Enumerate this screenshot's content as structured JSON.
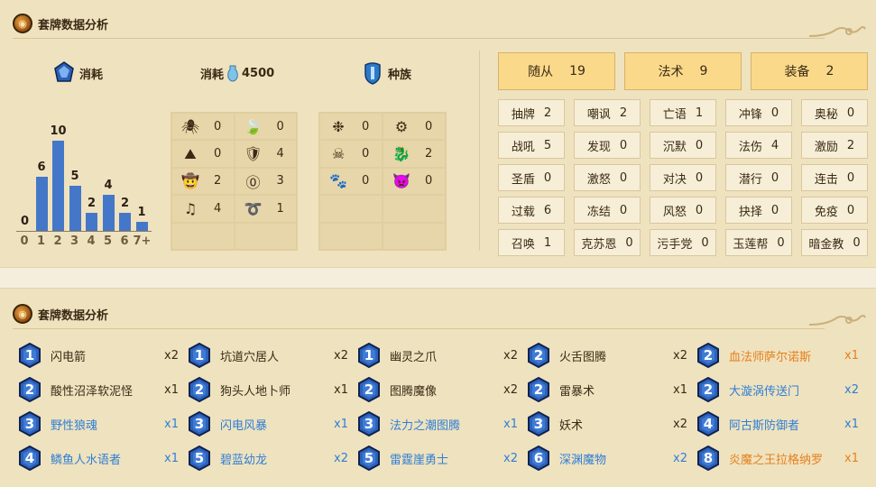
{
  "section1": {
    "title": "套牌数据分析"
  },
  "section2": {
    "title": "套牌数据分析"
  },
  "cost_header": {
    "label": "消耗"
  },
  "dust_header": {
    "label": "消耗",
    "value": "4500"
  },
  "race_header": {
    "label": "种族"
  },
  "chart_data": {
    "type": "bar",
    "categories": [
      "0",
      "1",
      "2",
      "3",
      "4",
      "5",
      "6",
      "7+"
    ],
    "values": [
      0,
      6,
      10,
      5,
      2,
      4,
      2,
      1
    ],
    "ylim": [
      0,
      10
    ],
    "color": "#4577c9"
  },
  "class_grid": [
    {
      "icon": "spider-icon",
      "glyph": "🕷",
      "value": "0"
    },
    {
      "icon": "leaf-icon",
      "glyph": "🍃",
      "value": "0"
    },
    {
      "icon": "mountain-icon",
      "glyph": "⛰",
      "value": "0"
    },
    {
      "icon": "shield-icon",
      "glyph": "🛡",
      "value": "4"
    },
    {
      "icon": "cowboy-hat-icon",
      "glyph": "🤠",
      "value": "2"
    },
    {
      "icon": "purple-rune-icon",
      "glyph": "⓪",
      "value": "3"
    },
    {
      "icon": "music-note-icon",
      "glyph": "♫",
      "value": "4"
    },
    {
      "icon": "golden-coil-icon",
      "glyph": "➰",
      "value": "1"
    }
  ],
  "race_grid": [
    {
      "icon": "blue-elemental-icon",
      "glyph": "❉",
      "value": "0"
    },
    {
      "icon": "gear-icon",
      "glyph": "⚙",
      "value": "0"
    },
    {
      "icon": "pirate-skull-icon",
      "glyph": "☠",
      "value": "0"
    },
    {
      "icon": "green-dragon-icon",
      "glyph": "🐉",
      "value": "2"
    },
    {
      "icon": "paw-icon",
      "glyph": "🐾",
      "value": "0"
    },
    {
      "icon": "demon-icon",
      "glyph": "👿",
      "value": "0"
    }
  ],
  "types": [
    {
      "label": "随从",
      "value": "19"
    },
    {
      "label": "法术",
      "value": "9"
    },
    {
      "label": "装备",
      "value": "2"
    }
  ],
  "mechanics": [
    {
      "label": "抽牌",
      "value": "2"
    },
    {
      "label": "嘲讽",
      "value": "2"
    },
    {
      "label": "亡语",
      "value": "1"
    },
    {
      "label": "冲锋",
      "value": "0"
    },
    {
      "label": "奥秘",
      "value": "0"
    },
    {
      "label": "战吼",
      "value": "5"
    },
    {
      "label": "发现",
      "value": "0"
    },
    {
      "label": "沉默",
      "value": "0"
    },
    {
      "label": "法伤",
      "value": "4"
    },
    {
      "label": "激励",
      "value": "2"
    },
    {
      "label": "圣盾",
      "value": "0"
    },
    {
      "label": "激怒",
      "value": "0"
    },
    {
      "label": "对决",
      "value": "0"
    },
    {
      "label": "潜行",
      "value": "0"
    },
    {
      "label": "连击",
      "value": "0"
    },
    {
      "label": "过载",
      "value": "6"
    },
    {
      "label": "冻结",
      "value": "0"
    },
    {
      "label": "风怒",
      "value": "0"
    },
    {
      "label": "抉择",
      "value": "0"
    },
    {
      "label": "免疫",
      "value": "0"
    },
    {
      "label": "召唤",
      "value": "1"
    },
    {
      "label": "克苏恩",
      "value": "0"
    },
    {
      "label": "污手党",
      "value": "0"
    },
    {
      "label": "玉莲帮",
      "value": "0"
    },
    {
      "label": "暗金教",
      "value": "0"
    }
  ],
  "cards": [
    {
      "cost": "1",
      "name": "闪电箭",
      "count": "x2",
      "rarity": "common"
    },
    {
      "cost": "1",
      "name": "坑道穴居人",
      "count": "x2",
      "rarity": "common"
    },
    {
      "cost": "1",
      "name": "幽灵之爪",
      "count": "x2",
      "rarity": "common"
    },
    {
      "cost": "2",
      "name": "火舌图腾",
      "count": "x2",
      "rarity": "common"
    },
    {
      "cost": "2",
      "name": "血法师萨尔诺斯",
      "count": "x1",
      "rarity": "legend"
    },
    {
      "cost": "2",
      "name": "酸性沼泽软泥怪",
      "count": "x1",
      "rarity": "common"
    },
    {
      "cost": "2",
      "name": "狗头人地卜师",
      "count": "x1",
      "rarity": "common"
    },
    {
      "cost": "2",
      "name": "图腾魔像",
      "count": "x2",
      "rarity": "common"
    },
    {
      "cost": "2",
      "name": "雷暴术",
      "count": "x1",
      "rarity": "common"
    },
    {
      "cost": "2",
      "name": "大漩涡传送门",
      "count": "x2",
      "rarity": "rare"
    },
    {
      "cost": "3",
      "name": "野性狼魂",
      "count": "x1",
      "rarity": "rare"
    },
    {
      "cost": "3",
      "name": "闪电风暴",
      "count": "x1",
      "rarity": "rare"
    },
    {
      "cost": "3",
      "name": "法力之潮图腾",
      "count": "x1",
      "rarity": "rare"
    },
    {
      "cost": "3",
      "name": "妖术",
      "count": "x2",
      "rarity": "common"
    },
    {
      "cost": "4",
      "name": "阿古斯防御者",
      "count": "x1",
      "rarity": "rare"
    },
    {
      "cost": "4",
      "name": "鳞鱼人水语者",
      "count": "x1",
      "rarity": "rare"
    },
    {
      "cost": "5",
      "name": "碧蓝幼龙",
      "count": "x2",
      "rarity": "rare"
    },
    {
      "cost": "5",
      "name": "雷霆崖勇士",
      "count": "x2",
      "rarity": "rare"
    },
    {
      "cost": "6",
      "name": "深渊魔物",
      "count": "x2",
      "rarity": "rare"
    },
    {
      "cost": "8",
      "name": "炎魔之王拉格纳罗",
      "count": "x1",
      "rarity": "legend"
    }
  ]
}
